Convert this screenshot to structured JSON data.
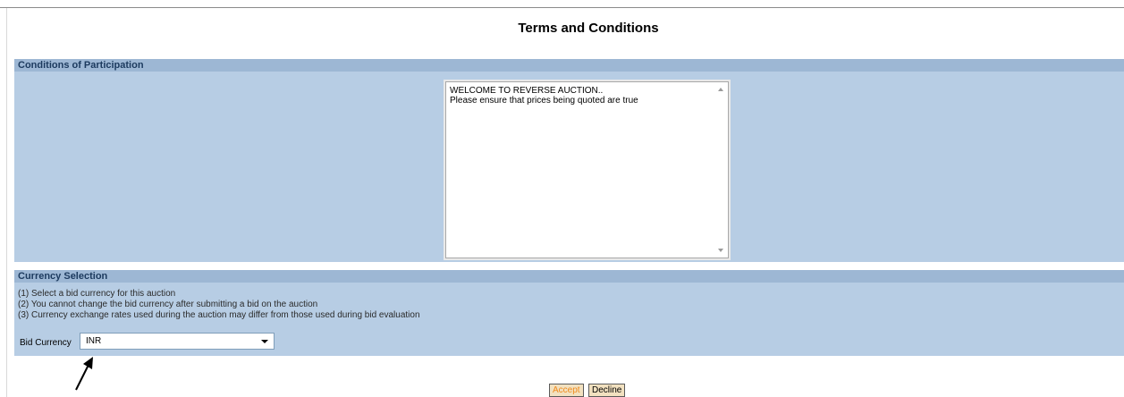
{
  "page": {
    "title": "Terms and Conditions"
  },
  "conditions": {
    "header": "Conditions of Participation",
    "text": "WELCOME TO REVERSE AUCTION..\nPlease ensure that prices being quoted are true"
  },
  "currency": {
    "header": "Currency Selection",
    "notes": [
      "(1) Select a bid currency for this auction",
      "(2) You cannot change the bid currency after submitting a bid on the auction",
      "(3) Currency exchange rates used during the auction may differ from those used during bid evaluation"
    ],
    "bid_label": "Bid Currency",
    "bid_value": "INR"
  },
  "actions": {
    "accept_label": "Accept",
    "decline_label": "Decline"
  },
  "colors": {
    "section_header": "#9db7d4",
    "section_body": "#b7cde4",
    "accept_text": "#f08a1c"
  },
  "icons": {
    "annotation": "arrow-icon",
    "dropdown": "chevron-down-icon"
  }
}
